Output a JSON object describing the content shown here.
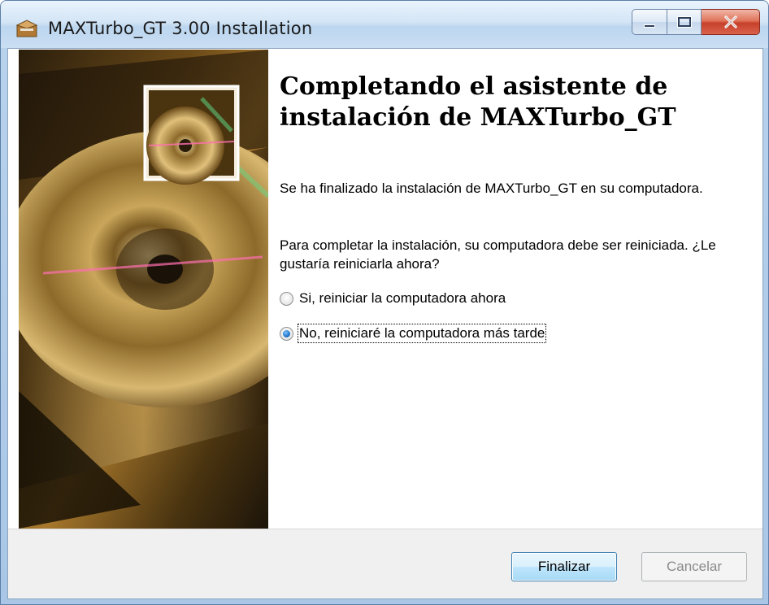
{
  "window": {
    "title": "MAXTurbo_GT 3.00 Installation",
    "icon": "installer-box-icon",
    "controls": {
      "minimize": "minimize-icon",
      "maximize": "maximize-icon",
      "close": "close-icon"
    }
  },
  "banner": {
    "image": "cd-disc-banner"
  },
  "content": {
    "heading": "Completando el asistente de instalación de MAXTurbo_GT",
    "paragraph1": "Se ha finalizado la instalación de MAXTurbo_GT en su computadora.",
    "paragraph2": "Para completar la instalación, su computadora debe ser reiniciada. ¿Le gustaría reiniciarla ahora?",
    "options": [
      {
        "label": "Si, reiniciar la computadora ahora",
        "selected": false
      },
      {
        "label": "No, reiniciaré la computadora más tarde",
        "selected": true
      }
    ]
  },
  "footer": {
    "finish_label": "Finalizar",
    "cancel_label": "Cancelar",
    "cancel_enabled": false
  },
  "colors": {
    "accent": "#3c7fb1",
    "close_button": "#c7402a",
    "disabled_text": "#8a8a8a"
  }
}
